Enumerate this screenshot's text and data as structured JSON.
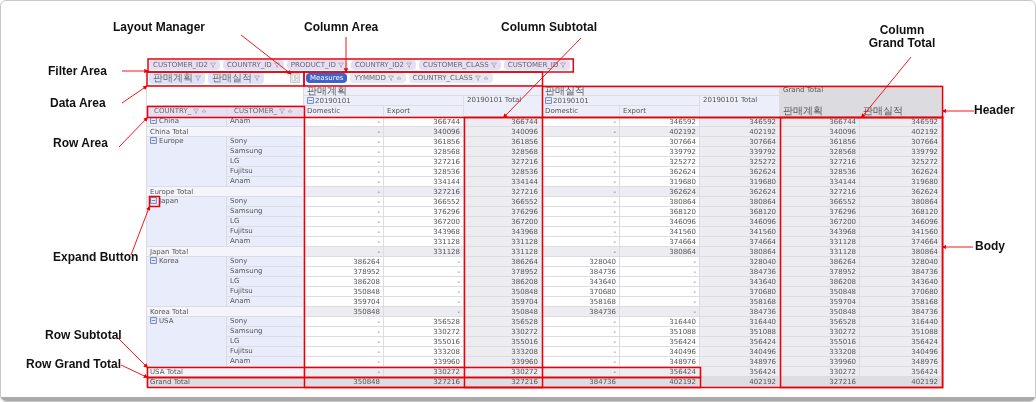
{
  "filter_area": {
    "chips": [
      "CUSTOMER_ID2",
      "COUNTRY_ID",
      "PRODUCT_ID",
      "COUNTRY_ID2",
      "CUSTOMER_CLASS",
      "CUSTOMER_ID"
    ]
  },
  "data_area": {
    "chips": [
      "판매계획",
      "판매실적"
    ]
  },
  "column_area": {
    "chips": [
      {
        "label": "Measures",
        "selected": true
      },
      {
        "label": "YYMMDD",
        "selected": false
      },
      {
        "label": "COUNTRY_CLASS",
        "selected": false
      }
    ]
  },
  "row_area": {
    "chips": [
      "COUNTRY_",
      "CUSTOMER_"
    ]
  },
  "header": {
    "measures": [
      {
        "label": "판매계획",
        "date": "20190101",
        "expanded": true,
        "subtotal": "20190101 Total",
        "columns": [
          "Domestic",
          "Export"
        ]
      },
      {
        "label": "판매실적",
        "date": "20190101",
        "expanded": true,
        "subtotal": "20190101 Total",
        "columns": [
          "Domestic",
          "Export"
        ]
      }
    ],
    "grand_total": {
      "label": "Grand Total",
      "columns": [
        "판매계획",
        "판매실적"
      ]
    }
  },
  "rows": [
    {
      "country": "China",
      "expanded": true,
      "customers": [
        {
          "name": "Anam",
          "values": [
            "-",
            "366744",
            "366744",
            "-",
            "346592",
            "346592",
            "366744",
            "346592"
          ]
        }
      ],
      "total": {
        "label": "China Total",
        "values": [
          "-",
          "340096",
          "340096",
          "-",
          "402192",
          "402192",
          "340096",
          "402192"
        ]
      }
    },
    {
      "country": "Europe",
      "expanded": true,
      "customers": [
        {
          "name": "Sony",
          "values": [
            "-",
            "361856",
            "361856",
            "-",
            "307664",
            "307664",
            "361856",
            "307664"
          ]
        },
        {
          "name": "Samsung",
          "values": [
            "-",
            "328568",
            "328568",
            "-",
            "339792",
            "339792",
            "328568",
            "339792"
          ]
        },
        {
          "name": "LG",
          "values": [
            "-",
            "327216",
            "327216",
            "-",
            "325272",
            "325272",
            "327216",
            "325272"
          ]
        },
        {
          "name": "Fujitsu",
          "values": [
            "-",
            "328536",
            "328536",
            "-",
            "362624",
            "362624",
            "328536",
            "362624"
          ]
        },
        {
          "name": "Anam",
          "values": [
            "-",
            "334144",
            "334144",
            "-",
            "319680",
            "319680",
            "334144",
            "319680"
          ]
        }
      ],
      "total": {
        "label": "Europe Total",
        "values": [
          "-",
          "327216",
          "327216",
          "-",
          "362624",
          "362624",
          "327216",
          "362624"
        ]
      }
    },
    {
      "country": "Japan",
      "expanded": true,
      "customers": [
        {
          "name": "Sony",
          "values": [
            "-",
            "366552",
            "366552",
            "-",
            "380864",
            "380864",
            "366552",
            "380864"
          ]
        },
        {
          "name": "Samsung",
          "values": [
            "-",
            "376296",
            "376296",
            "-",
            "368120",
            "368120",
            "376296",
            "368120"
          ]
        },
        {
          "name": "LG",
          "values": [
            "-",
            "367200",
            "367200",
            "-",
            "346096",
            "346096",
            "367200",
            "346096"
          ]
        },
        {
          "name": "Fujitsu",
          "values": [
            "-",
            "343968",
            "343968",
            "-",
            "341560",
            "341560",
            "343968",
            "341560"
          ]
        },
        {
          "name": "Anam",
          "values": [
            "-",
            "331128",
            "331128",
            "-",
            "374664",
            "374664",
            "331128",
            "374664"
          ]
        }
      ],
      "total": {
        "label": "Japan Total",
        "values": [
          "-",
          "331128",
          "331128",
          "-",
          "380864",
          "380864",
          "331128",
          "380864"
        ]
      }
    },
    {
      "country": "Korea",
      "expanded": true,
      "customers": [
        {
          "name": "Sony",
          "values": [
            "386264",
            "-",
            "386264",
            "328040",
            "-",
            "328040",
            "386264",
            "328040"
          ]
        },
        {
          "name": "Samsung",
          "values": [
            "378952",
            "-",
            "378952",
            "384736",
            "-",
            "384736",
            "378952",
            "384736"
          ]
        },
        {
          "name": "LG",
          "values": [
            "386208",
            "-",
            "386208",
            "343640",
            "-",
            "343640",
            "386208",
            "343640"
          ]
        },
        {
          "name": "Fujitsu",
          "values": [
            "350848",
            "-",
            "350848",
            "370680",
            "-",
            "370680",
            "350848",
            "370680"
          ]
        },
        {
          "name": "Anam",
          "values": [
            "359704",
            "-",
            "359704",
            "358168",
            "-",
            "358168",
            "359704",
            "358168"
          ]
        }
      ],
      "total": {
        "label": "Korea Total",
        "values": [
          "350848",
          "-",
          "350848",
          "384736",
          "-",
          "384736",
          "350848",
          "384736"
        ]
      }
    },
    {
      "country": "USA",
      "expanded": true,
      "customers": [
        {
          "name": "Sony",
          "values": [
            "-",
            "356528",
            "356528",
            "-",
            "316440",
            "316440",
            "356528",
            "316440"
          ]
        },
        {
          "name": "Samsung",
          "values": [
            "-",
            "330272",
            "330272",
            "-",
            "351088",
            "351088",
            "330272",
            "351088"
          ]
        },
        {
          "name": "LG",
          "values": [
            "-",
            "355016",
            "355016",
            "-",
            "356424",
            "356424",
            "355016",
            "356424"
          ]
        },
        {
          "name": "Fujitsu",
          "values": [
            "-",
            "333208",
            "333208",
            "-",
            "340496",
            "340496",
            "333208",
            "340496"
          ]
        },
        {
          "name": "Anam",
          "values": [
            "-",
            "339960",
            "339960",
            "-",
            "348976",
            "348976",
            "339960",
            "348976"
          ]
        }
      ],
      "total": {
        "label": "USA Total",
        "values": [
          "-",
          "330272",
          "330272",
          "-",
          "356424",
          "356424",
          "330272",
          "356424"
        ]
      }
    }
  ],
  "grand_total": {
    "label": "Grand Total",
    "values": [
      "350848",
      "327216",
      "327216",
      "384736",
      "402192",
      "402192",
      "327216",
      "402192"
    ]
  },
  "annotations": [
    "Layout Manager",
    "Column Area",
    "Column Subtotal",
    "Column Grand Total",
    "Filter Area",
    "Data Area",
    "Row Area",
    "Header",
    "Expand Button",
    "Body",
    "Row Subtotal",
    "Row Grand Total"
  ]
}
